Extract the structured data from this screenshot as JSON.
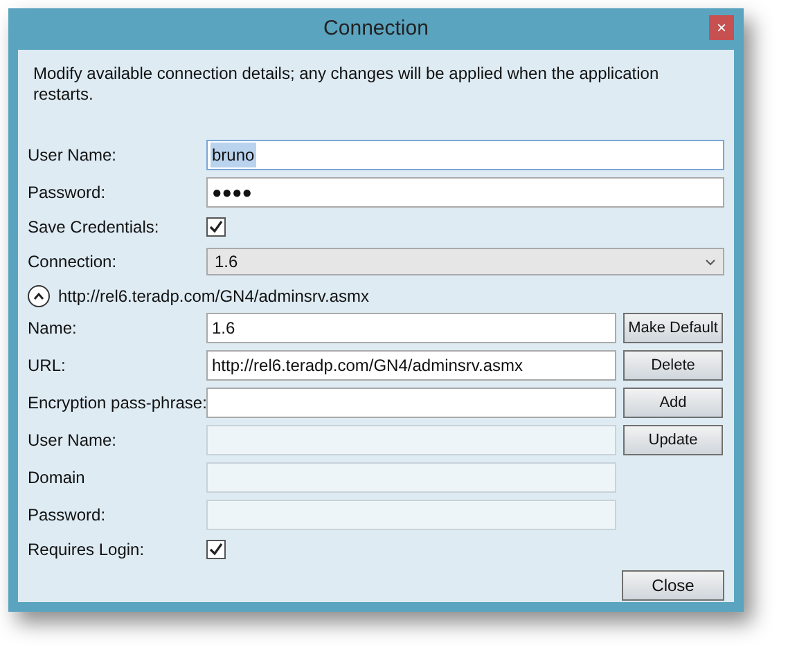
{
  "window": {
    "title": "Connection",
    "close": "×"
  },
  "intro": "Modify available connection details; any changes will be applied when the application restarts.",
  "credentials": [
    {
      "kind": "text",
      "label": "User Name:",
      "value": "bruno",
      "highlighted": true
    },
    {
      "kind": "text",
      "label": "Password:",
      "value": "●●●●",
      "highlighted": false
    },
    {
      "kind": "checkbox",
      "label": "Save Credentials:",
      "checked": true
    },
    {
      "kind": "select",
      "label": "Connection:",
      "value": "1.6"
    }
  ],
  "section": {
    "expanded": true,
    "title": "http://rel6.teradp.com/GN4/adminsrv.asmx"
  },
  "details": [
    {
      "kind": "text",
      "label": "Name:",
      "value": "1.6",
      "disabled": false,
      "button": "Make Default"
    },
    {
      "kind": "text",
      "label": "URL:",
      "value": "http://rel6.teradp.com/GN4/adminsrv.asmx",
      "disabled": false,
      "button": "Delete"
    },
    {
      "kind": "text",
      "label": "Encryption pass-phrase:",
      "disabled": false,
      "button": "Add"
    },
    {
      "kind": "text",
      "label": "User Name:",
      "disabled": true,
      "button": "Update"
    },
    {
      "kind": "text",
      "label": "Domain",
      "disabled": true
    },
    {
      "kind": "text",
      "label": "Password:",
      "disabled": true
    },
    {
      "kind": "checkbox",
      "label": "Requires Login:",
      "checked": true
    }
  ],
  "buttons": [
    "Close"
  ]
}
